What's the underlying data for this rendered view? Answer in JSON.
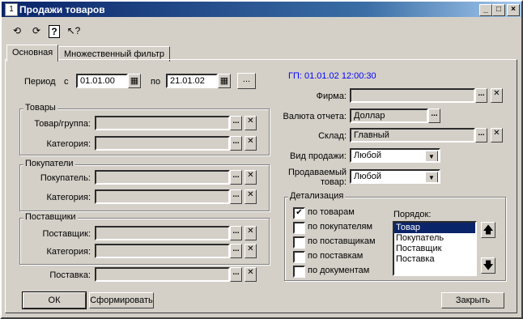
{
  "window": {
    "title": "Продажи товаров",
    "minimize": "_",
    "maximize": "□",
    "close": "×"
  },
  "toolbar": {
    "icons": [
      "refresh-left-icon",
      "refresh-right-icon",
      "help-icon",
      "pointer-help-icon"
    ]
  },
  "tabs": [
    {
      "label": "Основная",
      "active": true
    },
    {
      "label": "Множественный фильтр",
      "active": false
    }
  ],
  "period": {
    "label": "Период",
    "from_label": "с",
    "from": "01.01.00",
    "to_label": "по",
    "to": "21.01.02",
    "more_button": "..."
  },
  "gp": "ГП: 01.01.02 12:00:30",
  "goods_group": {
    "title": "Товары",
    "item_label": "Товар/группа:",
    "item_value": "",
    "category_label": "Категория:",
    "category_value": ""
  },
  "buyers_group": {
    "title": "Покупатели",
    "buyer_label": "Покупатель:",
    "buyer_value": "",
    "category_label": "Категория:",
    "category_value": ""
  },
  "suppliers_group": {
    "title": "Поставщики",
    "supplier_label": "Поставщик:",
    "supplier_value": "",
    "category_label": "Категория:",
    "category_value": ""
  },
  "delivery": {
    "label": "Поставка:",
    "value": ""
  },
  "firm": {
    "label": "Фирма:",
    "value": ""
  },
  "currency": {
    "label": "Валюта отчета:",
    "value": "Доллар"
  },
  "warehouse": {
    "label": "Склад:",
    "value": "Главный"
  },
  "sale_type": {
    "label": "Вид продажи:",
    "value": "Любой"
  },
  "sold_goods": {
    "label_line1": "Продаваемый",
    "label_line2": "товар:",
    "value": "Любой"
  },
  "detail": {
    "title": "Детализация",
    "options": [
      {
        "label": "по товарам",
        "checked": true
      },
      {
        "label": "по покупателям",
        "checked": false
      },
      {
        "label": "по поставщикам",
        "checked": false
      },
      {
        "label": "по поставкам",
        "checked": false
      },
      {
        "label": "по документам",
        "checked": false
      }
    ],
    "order_label": "Порядок:",
    "order_items": [
      "Товар",
      "Покупатель",
      "Поставщик",
      "Поставка"
    ],
    "selected_index": 0
  },
  "buttons": {
    "ok": "ОК",
    "form": "Сформировать",
    "close": "Закрыть",
    "dots": "...",
    "clear": "✕"
  },
  "colors": {
    "title_start": "#0a246a",
    "title_end": "#a6caf0",
    "gp_text": "#0000ff",
    "face": "#d4d0c8"
  }
}
